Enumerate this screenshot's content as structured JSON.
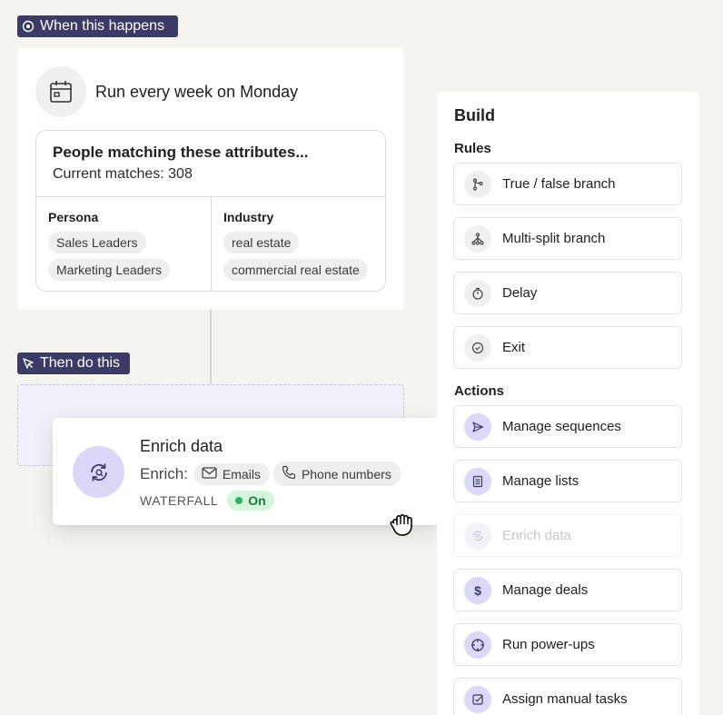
{
  "trigger": {
    "tag_label": "When this happens",
    "title": "Run every week on Monday",
    "attributes_heading": "People matching these attributes...",
    "current_matches": "Current matches: 308",
    "persona_label": "Persona",
    "persona_values": [
      "Sales Leaders",
      "Marketing Leaders"
    ],
    "industry_label": "Industry",
    "industry_values": [
      "real estate",
      "commercial real estate"
    ]
  },
  "action": {
    "tag_label": "Then do this",
    "card_title": "Enrich data",
    "enrich_label": "Enrich:",
    "pills": [
      "Emails",
      "Phone numbers"
    ],
    "waterfall_label": "WATERFALL",
    "status": "On"
  },
  "build": {
    "title": "Build",
    "rules_label": "Rules",
    "rules": [
      {
        "label": "True / false branch",
        "icon": "branch-icon"
      },
      {
        "label": "Multi-split branch",
        "icon": "multi-split-icon"
      },
      {
        "label": "Delay",
        "icon": "stopwatch-icon"
      },
      {
        "label": "Exit",
        "icon": "check-circle-icon"
      }
    ],
    "actions_label": "Actions",
    "actions": [
      {
        "label": "Manage sequences",
        "icon": "send-icon"
      },
      {
        "label": "Manage lists",
        "icon": "list-icon"
      },
      {
        "label": "Enrich data",
        "icon": "enrich-icon",
        "disabled": true
      },
      {
        "label": "Manage deals",
        "icon": "dollar-icon"
      },
      {
        "label": "Run power-ups",
        "icon": "target-icon"
      },
      {
        "label": "Assign manual tasks",
        "icon": "checkbox-icon"
      }
    ]
  },
  "colors": {
    "tag_bg": "#3c3b66",
    "accent_purple": "#ddd8f7",
    "status_green": "#2db55d",
    "page_bg": "#f5f4f0"
  }
}
